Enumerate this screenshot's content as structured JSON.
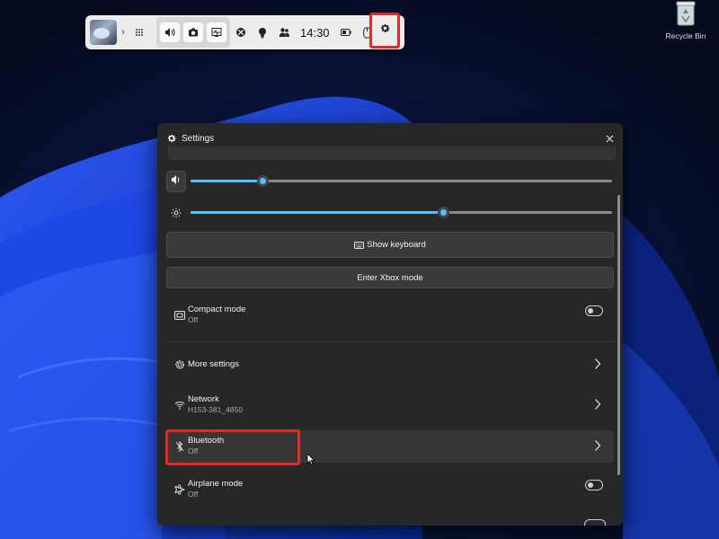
{
  "gamebar": {
    "time": "14:30",
    "chevron": "›",
    "icons": [
      "app-thumbnail",
      "widget-grid-icon",
      "volume-icon",
      "camera-icon",
      "performance-icon",
      "xbox-icon",
      "tips-icon",
      "social-icon",
      "battery-icon",
      "mouse-icon",
      "gear-icon"
    ]
  },
  "desktop": {
    "recycle_bin_label": "Recycle Bin"
  },
  "settings": {
    "title": "Settings",
    "volume_value": 0.17,
    "brightness_value": 0.6,
    "show_keyboard_label": "Show keyboard",
    "xbox_mode_label": "Enter Xbox mode",
    "compact_mode": {
      "title": "Compact mode",
      "status": "Off"
    },
    "more_settings": {
      "title": "More settings"
    },
    "network": {
      "title": "Network",
      "status": "H153-381_4850"
    },
    "bluetooth": {
      "title": "Bluetooth",
      "status": "Off"
    },
    "airplane_mode": {
      "title": "Airplane mode",
      "status": "Off"
    }
  },
  "colors": {
    "accent": "#4cc2ff",
    "highlight_box": "#e02b2b",
    "panel_bg": "#272727"
  }
}
